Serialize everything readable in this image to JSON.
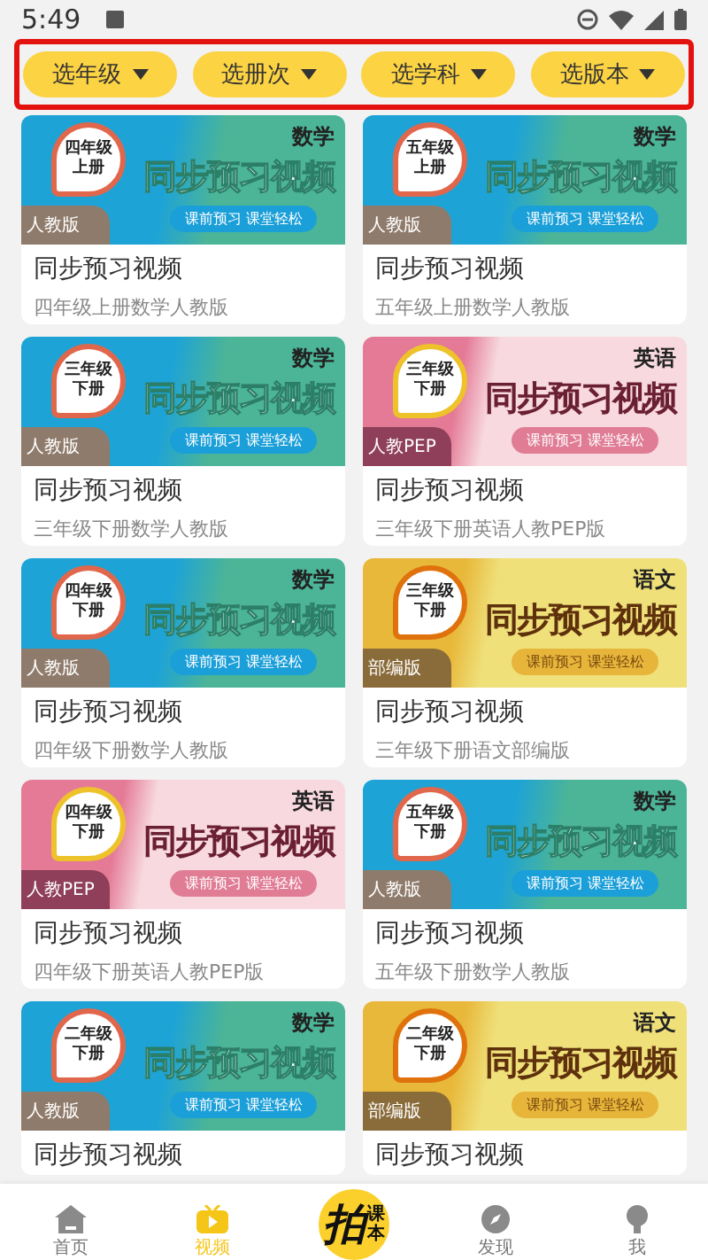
{
  "status_bar": {
    "time": "5:49"
  },
  "filters": [
    {
      "label": "选年级"
    },
    {
      "label": "选册次"
    },
    {
      "label": "选学科"
    },
    {
      "label": "选版本"
    }
  ],
  "cards": [
    {
      "kind": "blue",
      "grade": "四年级",
      "term": "上册",
      "subject": "数学",
      "edition": "人教版",
      "banner": "同步预习视频",
      "tagline": "课前预习 课堂轻松",
      "title": "同步预习视频",
      "subtitle": "四年级上册数学人教版"
    },
    {
      "kind": "blue",
      "grade": "五年级",
      "term": "上册",
      "subject": "数学",
      "edition": "人教版",
      "banner": "同步预习视频",
      "tagline": "课前预习 课堂轻松",
      "title": "同步预习视频",
      "subtitle": "五年级上册数学人教版"
    },
    {
      "kind": "blue",
      "grade": "三年级",
      "term": "下册",
      "subject": "数学",
      "edition": "人教版",
      "banner": "同步预习视频",
      "tagline": "课前预习 课堂轻松",
      "title": "同步预习视频",
      "subtitle": "三年级下册数学人教版"
    },
    {
      "kind": "pink",
      "grade": "三年级",
      "term": "下册",
      "subject": "英语",
      "edition": "人教PEP",
      "banner": "同步预习视频",
      "tagline": "课前预习 课堂轻松",
      "title": "同步预习视频",
      "subtitle": "三年级下册英语人教PEP版"
    },
    {
      "kind": "blue",
      "grade": "四年级",
      "term": "下册",
      "subject": "数学",
      "edition": "人教版",
      "banner": "同步预习视频",
      "tagline": "课前预习 课堂轻松",
      "title": "同步预习视频",
      "subtitle": "四年级下册数学人教版"
    },
    {
      "kind": "yellow",
      "grade": "三年级",
      "term": "下册",
      "subject": "语文",
      "edition": "部编版",
      "banner": "同步预习视频",
      "tagline": "课前预习 课堂轻松",
      "title": "同步预习视频",
      "subtitle": "三年级下册语文部编版"
    },
    {
      "kind": "pink",
      "grade": "四年级",
      "term": "下册",
      "subject": "英语",
      "edition": "人教PEP",
      "banner": "同步预习视频",
      "tagline": "课前预习 课堂轻松",
      "title": "同步预习视频",
      "subtitle": "四年级下册英语人教PEP版"
    },
    {
      "kind": "blue",
      "grade": "五年级",
      "term": "下册",
      "subject": "数学",
      "edition": "人教版",
      "banner": "同步预习视频",
      "tagline": "课前预习 课堂轻松",
      "title": "同步预习视频",
      "subtitle": "五年级下册数学人教版"
    },
    {
      "kind": "blue",
      "grade": "二年级",
      "term": "下册",
      "subject": "数学",
      "edition": "人教版",
      "banner": "同步预习视频",
      "tagline": "课前预习 课堂轻松",
      "title": "同步预习视频"
    },
    {
      "kind": "yellow",
      "grade": "二年级",
      "term": "下册",
      "subject": "语文",
      "edition": "部编版",
      "banner": "同步预习视频",
      "tagline": "课前预习 课堂轻松",
      "title": "同步预习视频"
    }
  ],
  "nav": [
    {
      "kind": "tab",
      "label": "首页",
      "selected": false
    },
    {
      "kind": "tab",
      "label": "视频",
      "selected": true
    },
    {
      "kind": "center",
      "logo": "拍",
      "logo_small": "课本"
    },
    {
      "kind": "tab",
      "label": "发现",
      "selected": false
    },
    {
      "kind": "tab",
      "label": "我",
      "selected": false
    }
  ]
}
